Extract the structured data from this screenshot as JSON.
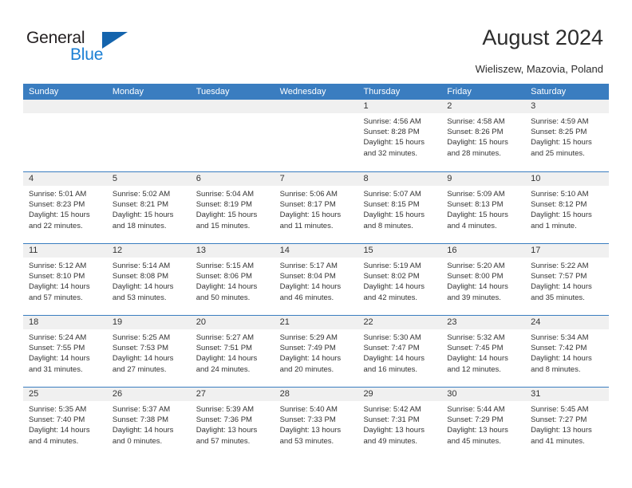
{
  "brand": {
    "name_part1": "General",
    "name_part2": "Blue",
    "logo_icon": "triangle-logo-icon",
    "accent_color": "#1b7fd4",
    "triangle_color": "#1464ad"
  },
  "header": {
    "title": "August 2024",
    "subtitle": "Wieliszew, Mazovia, Poland"
  },
  "calendar": {
    "header_bg": "#3a7dc0",
    "day_head_bg": "#f0f0f0",
    "weekdays": [
      "Sunday",
      "Monday",
      "Tuesday",
      "Wednesday",
      "Thursday",
      "Friday",
      "Saturday"
    ],
    "weeks": [
      [
        {
          "day": "",
          "sunrise": "",
          "sunset": "",
          "daylight_line1": "",
          "daylight_line2": "",
          "empty": true
        },
        {
          "day": "",
          "sunrise": "",
          "sunset": "",
          "daylight_line1": "",
          "daylight_line2": "",
          "empty": true
        },
        {
          "day": "",
          "sunrise": "",
          "sunset": "",
          "daylight_line1": "",
          "daylight_line2": "",
          "empty": true
        },
        {
          "day": "",
          "sunrise": "",
          "sunset": "",
          "daylight_line1": "",
          "daylight_line2": "",
          "empty": true
        },
        {
          "day": "1",
          "sunrise": "Sunrise: 4:56 AM",
          "sunset": "Sunset: 8:28 PM",
          "daylight_line1": "Daylight: 15 hours",
          "daylight_line2": "and 32 minutes.",
          "empty": false
        },
        {
          "day": "2",
          "sunrise": "Sunrise: 4:58 AM",
          "sunset": "Sunset: 8:26 PM",
          "daylight_line1": "Daylight: 15 hours",
          "daylight_line2": "and 28 minutes.",
          "empty": false
        },
        {
          "day": "3",
          "sunrise": "Sunrise: 4:59 AM",
          "sunset": "Sunset: 8:25 PM",
          "daylight_line1": "Daylight: 15 hours",
          "daylight_line2": "and 25 minutes.",
          "empty": false
        }
      ],
      [
        {
          "day": "4",
          "sunrise": "Sunrise: 5:01 AM",
          "sunset": "Sunset: 8:23 PM",
          "daylight_line1": "Daylight: 15 hours",
          "daylight_line2": "and 22 minutes.",
          "empty": false
        },
        {
          "day": "5",
          "sunrise": "Sunrise: 5:02 AM",
          "sunset": "Sunset: 8:21 PM",
          "daylight_line1": "Daylight: 15 hours",
          "daylight_line2": "and 18 minutes.",
          "empty": false
        },
        {
          "day": "6",
          "sunrise": "Sunrise: 5:04 AM",
          "sunset": "Sunset: 8:19 PM",
          "daylight_line1": "Daylight: 15 hours",
          "daylight_line2": "and 15 minutes.",
          "empty": false
        },
        {
          "day": "7",
          "sunrise": "Sunrise: 5:06 AM",
          "sunset": "Sunset: 8:17 PM",
          "daylight_line1": "Daylight: 15 hours",
          "daylight_line2": "and 11 minutes.",
          "empty": false
        },
        {
          "day": "8",
          "sunrise": "Sunrise: 5:07 AM",
          "sunset": "Sunset: 8:15 PM",
          "daylight_line1": "Daylight: 15 hours",
          "daylight_line2": "and 8 minutes.",
          "empty": false
        },
        {
          "day": "9",
          "sunrise": "Sunrise: 5:09 AM",
          "sunset": "Sunset: 8:13 PM",
          "daylight_line1": "Daylight: 15 hours",
          "daylight_line2": "and 4 minutes.",
          "empty": false
        },
        {
          "day": "10",
          "sunrise": "Sunrise: 5:10 AM",
          "sunset": "Sunset: 8:12 PM",
          "daylight_line1": "Daylight: 15 hours",
          "daylight_line2": "and 1 minute.",
          "empty": false
        }
      ],
      [
        {
          "day": "11",
          "sunrise": "Sunrise: 5:12 AM",
          "sunset": "Sunset: 8:10 PM",
          "daylight_line1": "Daylight: 14 hours",
          "daylight_line2": "and 57 minutes.",
          "empty": false
        },
        {
          "day": "12",
          "sunrise": "Sunrise: 5:14 AM",
          "sunset": "Sunset: 8:08 PM",
          "daylight_line1": "Daylight: 14 hours",
          "daylight_line2": "and 53 minutes.",
          "empty": false
        },
        {
          "day": "13",
          "sunrise": "Sunrise: 5:15 AM",
          "sunset": "Sunset: 8:06 PM",
          "daylight_line1": "Daylight: 14 hours",
          "daylight_line2": "and 50 minutes.",
          "empty": false
        },
        {
          "day": "14",
          "sunrise": "Sunrise: 5:17 AM",
          "sunset": "Sunset: 8:04 PM",
          "daylight_line1": "Daylight: 14 hours",
          "daylight_line2": "and 46 minutes.",
          "empty": false
        },
        {
          "day": "15",
          "sunrise": "Sunrise: 5:19 AM",
          "sunset": "Sunset: 8:02 PM",
          "daylight_line1": "Daylight: 14 hours",
          "daylight_line2": "and 42 minutes.",
          "empty": false
        },
        {
          "day": "16",
          "sunrise": "Sunrise: 5:20 AM",
          "sunset": "Sunset: 8:00 PM",
          "daylight_line1": "Daylight: 14 hours",
          "daylight_line2": "and 39 minutes.",
          "empty": false
        },
        {
          "day": "17",
          "sunrise": "Sunrise: 5:22 AM",
          "sunset": "Sunset: 7:57 PM",
          "daylight_line1": "Daylight: 14 hours",
          "daylight_line2": "and 35 minutes.",
          "empty": false
        }
      ],
      [
        {
          "day": "18",
          "sunrise": "Sunrise: 5:24 AM",
          "sunset": "Sunset: 7:55 PM",
          "daylight_line1": "Daylight: 14 hours",
          "daylight_line2": "and 31 minutes.",
          "empty": false
        },
        {
          "day": "19",
          "sunrise": "Sunrise: 5:25 AM",
          "sunset": "Sunset: 7:53 PM",
          "daylight_line1": "Daylight: 14 hours",
          "daylight_line2": "and 27 minutes.",
          "empty": false
        },
        {
          "day": "20",
          "sunrise": "Sunrise: 5:27 AM",
          "sunset": "Sunset: 7:51 PM",
          "daylight_line1": "Daylight: 14 hours",
          "daylight_line2": "and 24 minutes.",
          "empty": false
        },
        {
          "day": "21",
          "sunrise": "Sunrise: 5:29 AM",
          "sunset": "Sunset: 7:49 PM",
          "daylight_line1": "Daylight: 14 hours",
          "daylight_line2": "and 20 minutes.",
          "empty": false
        },
        {
          "day": "22",
          "sunrise": "Sunrise: 5:30 AM",
          "sunset": "Sunset: 7:47 PM",
          "daylight_line1": "Daylight: 14 hours",
          "daylight_line2": "and 16 minutes.",
          "empty": false
        },
        {
          "day": "23",
          "sunrise": "Sunrise: 5:32 AM",
          "sunset": "Sunset: 7:45 PM",
          "daylight_line1": "Daylight: 14 hours",
          "daylight_line2": "and 12 minutes.",
          "empty": false
        },
        {
          "day": "24",
          "sunrise": "Sunrise: 5:34 AM",
          "sunset": "Sunset: 7:42 PM",
          "daylight_line1": "Daylight: 14 hours",
          "daylight_line2": "and 8 minutes.",
          "empty": false
        }
      ],
      [
        {
          "day": "25",
          "sunrise": "Sunrise: 5:35 AM",
          "sunset": "Sunset: 7:40 PM",
          "daylight_line1": "Daylight: 14 hours",
          "daylight_line2": "and 4 minutes.",
          "empty": false
        },
        {
          "day": "26",
          "sunrise": "Sunrise: 5:37 AM",
          "sunset": "Sunset: 7:38 PM",
          "daylight_line1": "Daylight: 14 hours",
          "daylight_line2": "and 0 minutes.",
          "empty": false
        },
        {
          "day": "27",
          "sunrise": "Sunrise: 5:39 AM",
          "sunset": "Sunset: 7:36 PM",
          "daylight_line1": "Daylight: 13 hours",
          "daylight_line2": "and 57 minutes.",
          "empty": false
        },
        {
          "day": "28",
          "sunrise": "Sunrise: 5:40 AM",
          "sunset": "Sunset: 7:33 PM",
          "daylight_line1": "Daylight: 13 hours",
          "daylight_line2": "and 53 minutes.",
          "empty": false
        },
        {
          "day": "29",
          "sunrise": "Sunrise: 5:42 AM",
          "sunset": "Sunset: 7:31 PM",
          "daylight_line1": "Daylight: 13 hours",
          "daylight_line2": "and 49 minutes.",
          "empty": false
        },
        {
          "day": "30",
          "sunrise": "Sunrise: 5:44 AM",
          "sunset": "Sunset: 7:29 PM",
          "daylight_line1": "Daylight: 13 hours",
          "daylight_line2": "and 45 minutes.",
          "empty": false
        },
        {
          "day": "31",
          "sunrise": "Sunrise: 5:45 AM",
          "sunset": "Sunset: 7:27 PM",
          "daylight_line1": "Daylight: 13 hours",
          "daylight_line2": "and 41 minutes.",
          "empty": false
        }
      ]
    ]
  }
}
